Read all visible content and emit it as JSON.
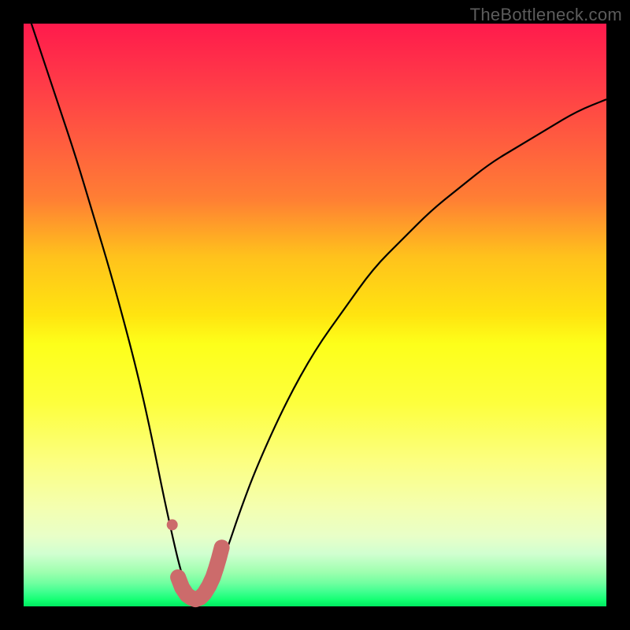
{
  "watermark": "TheBottleneck.com",
  "colors": {
    "frame": "#000000",
    "watermark_text": "#5c5c5c",
    "curve_stroke": "#000000",
    "marker_stroke": "#cc6b6b",
    "marker_fill": "#cc6b6b",
    "gradient_top": "#ff1a4c",
    "gradient_bottom": "#00e860"
  },
  "chart_data": {
    "type": "line",
    "title": "",
    "xlabel": "",
    "ylabel": "",
    "xlim": [
      0,
      100
    ],
    "ylim": [
      0,
      100
    ],
    "x": [
      0,
      3,
      6,
      9,
      12,
      15,
      18,
      20,
      22,
      24,
      26,
      27,
      28,
      29,
      30,
      31,
      32,
      33,
      35,
      37,
      40,
      45,
      50,
      55,
      60,
      65,
      70,
      75,
      80,
      85,
      90,
      95,
      100
    ],
    "y": [
      104,
      95,
      86,
      77,
      67,
      57,
      46,
      38,
      29,
      19,
      10,
      6,
      3,
      2,
      1,
      2,
      3,
      5,
      10,
      16,
      24,
      35,
      44,
      51,
      58,
      63,
      68,
      72,
      76,
      79,
      82,
      85,
      87
    ],
    "series": [
      {
        "name": "bottleneck_curve",
        "x": [
          0,
          3,
          6,
          9,
          12,
          15,
          18,
          20,
          22,
          24,
          26,
          27,
          28,
          29,
          30,
          31,
          32,
          33,
          35,
          37,
          40,
          45,
          50,
          55,
          60,
          65,
          70,
          75,
          80,
          85,
          90,
          95,
          100
        ],
        "y": [
          104,
          95,
          86,
          77,
          67,
          57,
          46,
          38,
          29,
          19,
          10,
          6,
          3,
          2,
          1,
          2,
          3,
          5,
          10,
          16,
          24,
          35,
          44,
          51,
          58,
          63,
          68,
          72,
          76,
          79,
          82,
          85,
          87
        ]
      }
    ],
    "markers": {
      "dot": {
        "x": 25.5,
        "y": 14
      },
      "bottom_segment": {
        "x": [
          26.5,
          27.2,
          28.0,
          28.7,
          29.5,
          30.3,
          31.0,
          31.8,
          32.5,
          33.0,
          33.5,
          34.0
        ],
        "y": [
          5.0,
          3.2,
          2.0,
          1.5,
          1.2,
          1.5,
          2.2,
          3.5,
          5.0,
          6.5,
          8.2,
          10.1
        ]
      }
    },
    "notes": "x/y in percent of plot area; y measured from bottom; curve values above 100 indicate the line extends beyond the visible top edge on the left side."
  }
}
